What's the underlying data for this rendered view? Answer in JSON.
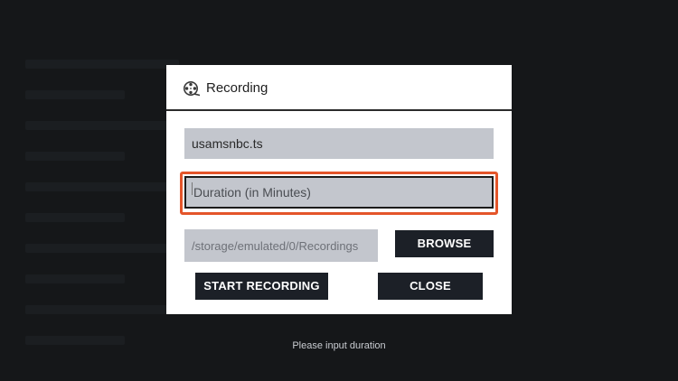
{
  "dialog": {
    "title": "Recording",
    "title_icon": "film-reel-icon"
  },
  "fields": {
    "filename_value": "usamsnbc.ts",
    "duration_placeholder": "Duration (in Minutes)",
    "path_value": "/storage/emulated/0/Recordings"
  },
  "buttons": {
    "browse": "BROWSE",
    "start_recording": "START RECORDING",
    "close": "CLOSE"
  },
  "toast": {
    "message": "Please input duration"
  },
  "colors": {
    "focus_ring": "#e4552a",
    "button_bg": "#1c2027",
    "field_bg": "#c3c6cd",
    "backdrop": "#151719"
  }
}
